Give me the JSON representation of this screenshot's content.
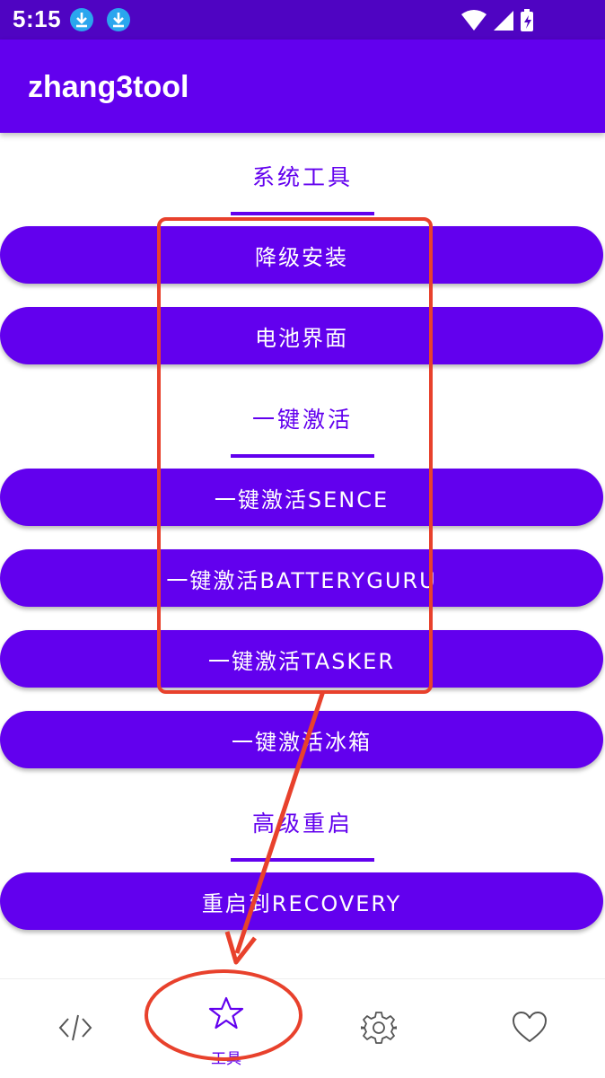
{
  "status_bar": {
    "time": "5:15"
  },
  "app_bar": {
    "title": "zhang3tool"
  },
  "sections": [
    {
      "title": "系统工具"
    },
    {
      "title": "一键激活"
    },
    {
      "title": "高级重启"
    }
  ],
  "buttons": [
    {
      "label": "降级安装"
    },
    {
      "label": "电池界面"
    },
    {
      "label": "一键激活SENCE"
    },
    {
      "label": "一键激活BATTERYGURU"
    },
    {
      "label": "一键激活TASKER"
    },
    {
      "label": "一键激活冰箱"
    },
    {
      "label": "重启到RECOVERY"
    }
  ],
  "bottom_nav": {
    "items": [
      {
        "icon": "code-icon",
        "label": ""
      },
      {
        "icon": "star-icon",
        "label": "工具"
      },
      {
        "icon": "gear-icon",
        "label": ""
      },
      {
        "icon": "heart-icon",
        "label": ""
      }
    ]
  },
  "colors": {
    "primary": "#6200ee",
    "status_bar": "#4f04c2",
    "annotation": "#e8412c"
  }
}
